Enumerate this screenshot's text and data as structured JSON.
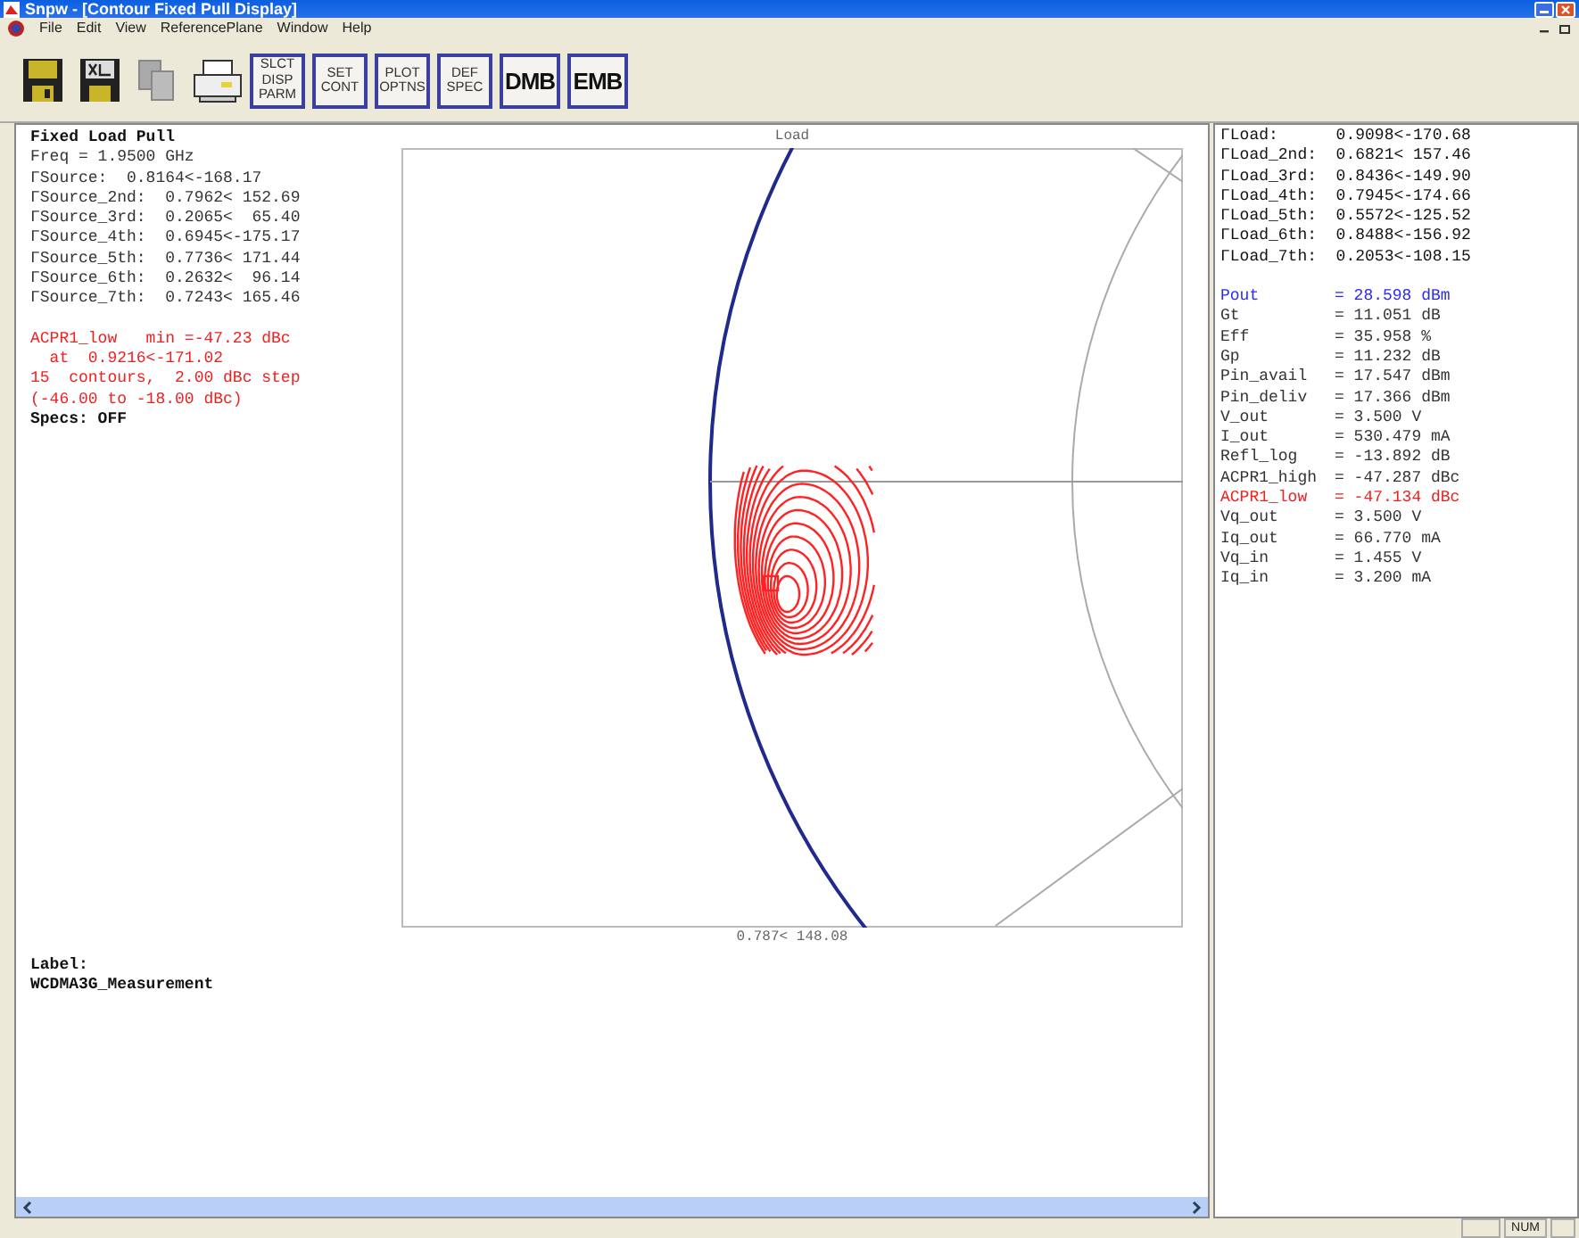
{
  "window": {
    "title": "Snpw - [Contour Fixed Pull Display]"
  },
  "menu": [
    "File",
    "Edit",
    "View",
    "ReferencePlane",
    "Window",
    "Help"
  ],
  "toolbar_buttons": [
    {
      "kind": "small",
      "lines": [
        "SLCT",
        "DISP",
        "PARM"
      ]
    },
    {
      "kind": "small",
      "lines": [
        "SET",
        "CONT"
      ]
    },
    {
      "kind": "small",
      "lines": [
        "PLOT",
        "OPTNS"
      ]
    },
    {
      "kind": "small",
      "lines": [
        "DEF",
        "SPEC"
      ]
    },
    {
      "kind": "large",
      "lines": [
        "DMB"
      ]
    },
    {
      "kind": "large",
      "lines": [
        "EMB"
      ]
    }
  ],
  "left_panel": {
    "title": "Fixed Load Pull",
    "lines": [
      "Freq = 1.9500 GHz",
      "ΓSource:  0.8164<-168.17",
      "ΓSource_2nd:  0.7962< 152.69",
      "ΓSource_3rd:  0.2065<  65.40",
      "ΓSource_4th:  0.6945<-175.17",
      "ΓSource_5th:  0.7736< 171.44",
      "ΓSource_6th:  0.2632<  96.14",
      "ΓSource_7th:  0.7243< 165.46"
    ],
    "contour_info": [
      "ACPR1_low   min =-47.23 dBc",
      "  at  0.9216<-171.02",
      "15  contours,  2.00 dBc step",
      "(-46.00 to -18.00 dBc)"
    ],
    "specs": "Specs: OFF"
  },
  "plot": {
    "title": "Load",
    "readout": "0.787< 148.08"
  },
  "label_section": {
    "title": "Label:",
    "value": "WCDMA3G_Measurement"
  },
  "right_panel": {
    "gammas": [
      "ΓLoad:      0.9098<-170.68",
      "ΓLoad_2nd:  0.6821< 157.46",
      "ΓLoad_3rd:  0.8436<-149.90",
      "ΓLoad_4th:  0.7945<-174.66",
      "ΓLoad_5th:  0.5572<-125.52",
      "ΓLoad_6th:  0.8488<-156.92",
      "ΓLoad_7th:  0.2053<-108.15"
    ],
    "measurements": [
      {
        "name": "Pout",
        "value": "= 28.598 dBm",
        "kind": "highlight"
      },
      {
        "name": "Gt",
        "value": "= 11.051 dB",
        "kind": "normal"
      },
      {
        "name": "Eff",
        "value": "= 35.958 %",
        "kind": "normal"
      },
      {
        "name": "Gp",
        "value": "= 11.232 dB",
        "kind": "normal"
      },
      {
        "name": "Pin_avail",
        "value": "= 17.547 dBm",
        "kind": "normal"
      },
      {
        "name": "Pin_deliv",
        "value": "= 17.366 dBm",
        "kind": "normal"
      },
      {
        "name": "V_out",
        "value": "= 3.500 V",
        "kind": "normal"
      },
      {
        "name": "I_out",
        "value": "= 530.479 mA",
        "kind": "normal"
      },
      {
        "name": "Refl_log",
        "value": "= -13.892 dB",
        "kind": "normal"
      },
      {
        "name": "ACPR1_high",
        "value": "= -47.287 dBc",
        "kind": "normal"
      },
      {
        "name": "ACPR1_low",
        "value": "= -47.134 dBc",
        "kind": "alert"
      },
      {
        "name": "Vq_out",
        "value": "= 3.500 V",
        "kind": "normal"
      },
      {
        "name": "Iq_out",
        "value": "= 66.770 mA",
        "kind": "normal"
      },
      {
        "name": "Vq_in",
        "value": "= 1.455 V",
        "kind": "normal"
      },
      {
        "name": "Iq_in",
        "value": "= 3.200 mA",
        "kind": "normal"
      }
    ]
  },
  "status_bar": {
    "indicator": "NUM"
  }
}
